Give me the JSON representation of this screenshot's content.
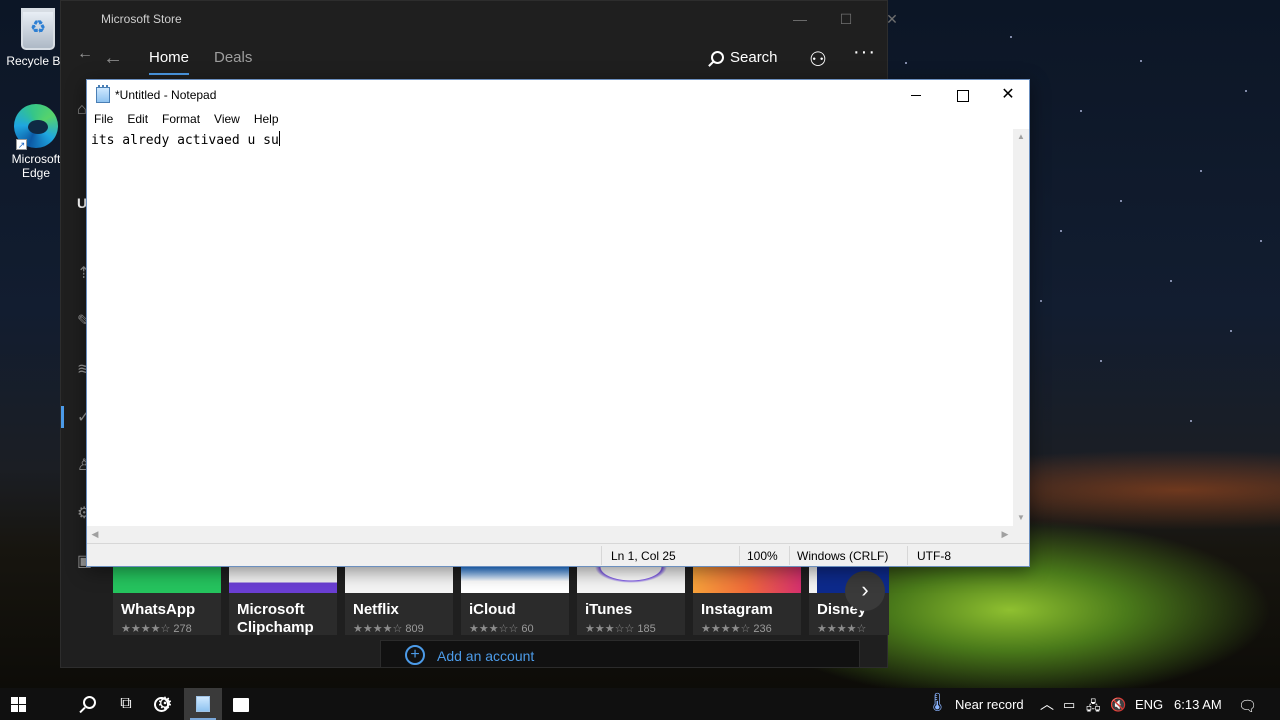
{
  "desktop": {
    "icons": [
      {
        "label": "Recycle Bin",
        "icon": "recycle-bin-icon"
      },
      {
        "label": "Microsoft Edge",
        "icon": "edge-icon"
      }
    ]
  },
  "store": {
    "title": "Microsoft Store",
    "tabs": [
      {
        "label": "Home",
        "active": true
      },
      {
        "label": "Deals",
        "active": false
      }
    ],
    "search_label": "Search",
    "sidebar_letter": "U",
    "apps": [
      {
        "name": "WhatsApp",
        "rating_count": "278",
        "art_color": "#25c45e"
      },
      {
        "name": "Microsoft Clipchamp",
        "rating_count": "",
        "art_color": "#6b3fd4"
      },
      {
        "name": "Netflix",
        "rating_count": "809",
        "art_color": "#f4f4f4"
      },
      {
        "name": "iCloud",
        "rating_count": "60",
        "art_color": "#2a7fe0"
      },
      {
        "name": "iTunes",
        "rating_count": "185",
        "art_color": "#7b56e8"
      },
      {
        "name": "Instagram",
        "rating_count": "236",
        "art_color": "#f06a3a"
      },
      {
        "name": "Disney",
        "rating_count": "",
        "art_color": "#0d2a8c"
      }
    ],
    "add_account_label": "Add an account"
  },
  "notepad": {
    "title": "*Untitled - Notepad",
    "menu": [
      "File",
      "Edit",
      "Format",
      "View",
      "Help"
    ],
    "content": "its alredy activaed u su",
    "status": {
      "position": "Ln 1, Col 25",
      "zoom": "100%",
      "line_endings": "Windows (CRLF)",
      "encoding": "UTF-8"
    }
  },
  "taskbar": {
    "weather_text": "Near record",
    "language": "ENG",
    "time": "6:13 AM"
  },
  "colors": {
    "accent": "#4c9be8",
    "store_bg": "#1f1f1f",
    "taskbar_bg": "#101010"
  }
}
